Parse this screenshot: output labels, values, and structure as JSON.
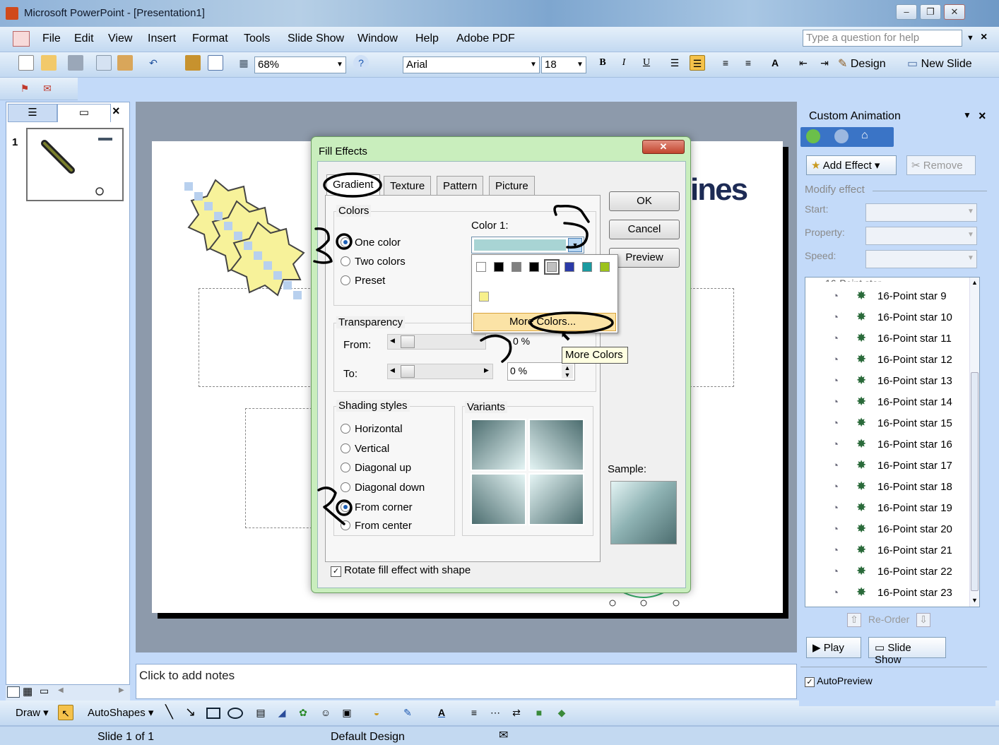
{
  "titlebar": {
    "title": "Microsoft PowerPoint - [Presentation1]"
  },
  "menu": {
    "items": [
      "File",
      "Edit",
      "View",
      "Insert",
      "Format",
      "Tools",
      "Slide Show",
      "Window",
      "Help",
      "Adobe PDF"
    ],
    "help_placeholder": "Type a question for help"
  },
  "toolbar": {
    "zoom": "68%",
    "font": "Arial",
    "font_size": "18",
    "bold": "B",
    "italic": "I",
    "underline": "U",
    "design_label": "Design",
    "new_slide_label": "New Slide"
  },
  "slides_pane": {
    "slide_number": "1"
  },
  "slide": {
    "wordart_fragment": "ines"
  },
  "notes": {
    "placeholder": "Click to add notes"
  },
  "dialog": {
    "title": "Fill Effects",
    "tabs": [
      "Gradient",
      "Texture",
      "Pattern",
      "Picture"
    ],
    "colors_group": "Colors",
    "color_options": [
      "One color",
      "Two colors",
      "Preset"
    ],
    "color1_label": "Color 1:",
    "more_colors": "More Colors...",
    "tooltip": "More Colors",
    "transparency_group": "Transparency",
    "from_label": "From:",
    "to_label": "To:",
    "from_value": "0 %",
    "to_value": "0 %",
    "shading_group": "Shading styles",
    "shading_options": [
      "Horizontal",
      "Vertical",
      "Diagonal up",
      "Diagonal down",
      "From corner",
      "From center"
    ],
    "variants_group": "Variants",
    "sample_label": "Sample:",
    "ok": "OK",
    "cancel": "Cancel",
    "preview": "Preview",
    "rotate_label": "Rotate fill effect with shape",
    "palette": [
      "#ffffff",
      "#000000",
      "#808080",
      "#000000",
      "#c0c0c0",
      "#2b3aa8",
      "#1a9aa0",
      "#9cc21c"
    ],
    "recent_color": "#f7f08c",
    "gradient_light": "#e4f4f4",
    "gradient_dark": "#4d6e70"
  },
  "custom_animation": {
    "title": "Custom Animation",
    "add_effect": "Add Effect",
    "remove": "Remove",
    "modify_label": "Modify effect",
    "start_label": "Start:",
    "property_label": "Property:",
    "speed_label": "Speed:",
    "items": [
      "16-Point star 9",
      "16-Point star 10",
      "16-Point star 11",
      "16-Point star 12",
      "16-Point star 13",
      "16-Point star 14",
      "16-Point star 15",
      "16-Point star 16",
      "16-Point star 17",
      "16-Point star 18",
      "16-Point star 19",
      "16-Point star 20",
      "16-Point star 21",
      "16-Point star 22",
      "16-Point star 23"
    ],
    "reorder": "Re-Order",
    "play": "Play",
    "slide_show": "Slide Show",
    "autopreview": "AutoPreview"
  },
  "drawing_toolbar": {
    "draw": "Draw",
    "autoshapes": "AutoShapes"
  },
  "status": {
    "slide": "Slide 1 of 1",
    "design": "Default Design"
  }
}
